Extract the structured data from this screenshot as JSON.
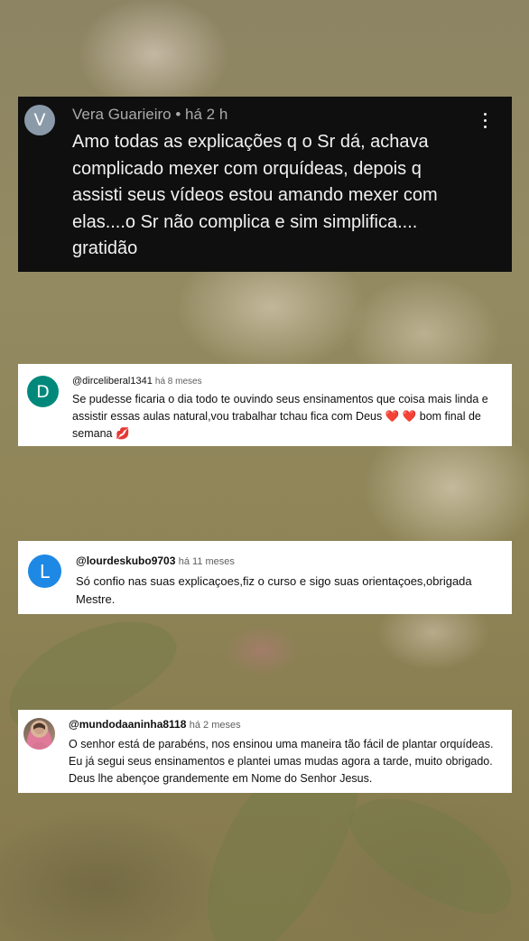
{
  "comments": [
    {
      "avatar_letter": "V",
      "avatar_color": "#8a9aa8",
      "author": "Vera Guarieiro",
      "separator": "•",
      "time": "há 2 h",
      "lines": [
        "Amo todas as explicações q o Sr dá, achava",
        "complicado mexer com orquídeas, depois q",
        "assisti seus vídeos estou amando mexer com",
        "elas....o Sr não complica e sim simplifica....",
        "gratidão"
      ],
      "menu_icon": "more-vert-icon"
    },
    {
      "avatar_letter": "D",
      "avatar_color": "#00897b",
      "author": "@dirceliberal1341",
      "time": "há 8 meses",
      "lines": [
        "Se pudesse ficaria o dia todo te ouvindo seus ensinamentos  que coisa mais linda e",
        "assistir essas aulas natural,vou trabalhar tchau fica com Deus ❤️ ❤️  bom final de",
        "semana 💋"
      ]
    },
    {
      "avatar_letter": "L",
      "avatar_color": "#1e88e5",
      "author": "@lourdeskubo9703",
      "time": "há 11 meses",
      "lines": [
        "Só  confio nas suas explicaçoes,fiz o curso e sigo suas orientaçoes,obrigada",
        "Mestre."
      ]
    },
    {
      "avatar_icon": "profile-photo",
      "author": "@mundodaaninha8118",
      "time": "há 2 meses",
      "lines": [
        "O senhor está de parabéns, nos ensinou uma maneira tão fácil de plantar orquídeas.",
        "Eu já segui seus ensinamentos e plantei umas mudas agora a tarde, muito obrigado.",
        "Deus lhe abençoe grandemente em Nome do Senhor Jesus."
      ]
    }
  ]
}
